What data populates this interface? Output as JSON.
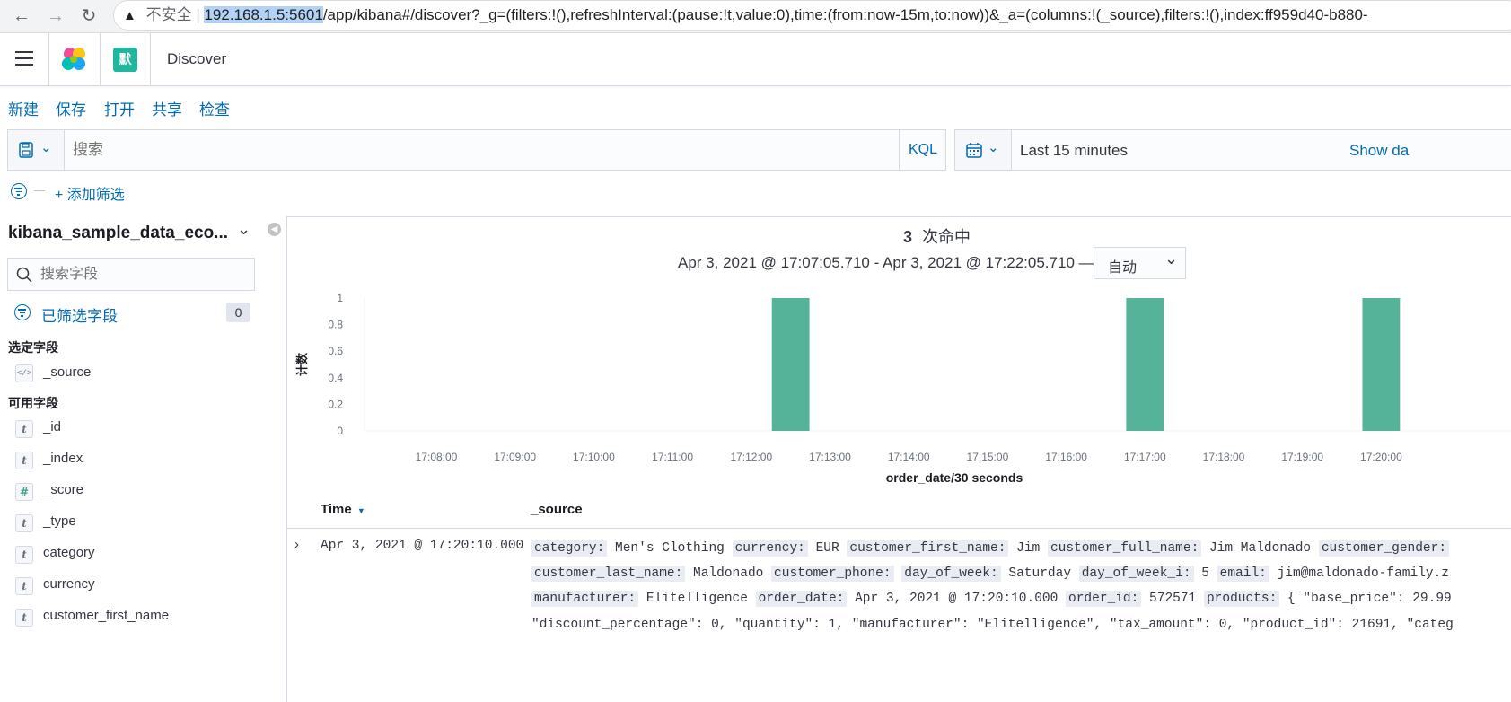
{
  "browser": {
    "security_label": "不安全",
    "url_host": "192.168.1.5:5601",
    "url_rest": "/app/kibana#/discover?_g=(filters:!(),refreshInterval:(pause:!t,value:0),time:(from:now-15m,to:now))&_a=(columns:!(_source),filters:!(),index:ff959d40-b880-"
  },
  "header": {
    "space_avatar": "默",
    "app_title": "Discover"
  },
  "top_nav": [
    "新建",
    "保存",
    "打开",
    "共享",
    "检查"
  ],
  "query": {
    "placeholder": "搜索",
    "language": "KQL"
  },
  "date_picker": {
    "range_label": "Last 15 minutes",
    "show_dates": "Show da"
  },
  "filters": {
    "add_filter": "+ 添加筛选"
  },
  "sidebar": {
    "index_pattern": "kibana_sample_data_eco...",
    "search_placeholder": "搜索字段",
    "filtered_fields_label": "已筛选字段",
    "filtered_count": "0",
    "selected_heading": "选定字段",
    "selected_fields": [
      {
        "type": "</>",
        "name": "_source"
      }
    ],
    "available_heading": "可用字段",
    "available_fields": [
      {
        "type": "t",
        "name": "_id"
      },
      {
        "type": "t",
        "name": "_index"
      },
      {
        "type": "#",
        "name": "_score"
      },
      {
        "type": "t",
        "name": "_type"
      },
      {
        "type": "t",
        "name": "category"
      },
      {
        "type": "t",
        "name": "currency"
      },
      {
        "type": "t",
        "name": "customer_first_name"
      }
    ]
  },
  "hits": {
    "count": "3",
    "label": "次命中",
    "range_text": "Apr 3, 2021 @ 17:07:05.710 - Apr 3, 2021 @ 17:22:05.710 —",
    "interval": "自动"
  },
  "chart_data": {
    "type": "bar",
    "xlabel": "order_date/30 seconds",
    "ylabel": "计数",
    "ylim": [
      0,
      1
    ],
    "yticks": [
      "1",
      "0.8",
      "0.6",
      "0.4",
      "0.2",
      "0"
    ],
    "xticks": [
      "17:08:00",
      "17:09:00",
      "17:10:00",
      "17:11:00",
      "17:12:00",
      "17:13:00",
      "17:14:00",
      "17:15:00",
      "17:16:00",
      "17:17:00",
      "17:18:00",
      "17:19:00",
      "17:20:00"
    ],
    "points": [
      {
        "x": "17:12:30",
        "y": 1
      },
      {
        "x": "17:17:00",
        "y": 1
      },
      {
        "x": "17:20:00",
        "y": 1
      }
    ],
    "color": "#54b399"
  },
  "table": {
    "col_time": "Time",
    "col_source": "_source",
    "row": {
      "time": "Apr 3, 2021 @ 17:20:10.000",
      "line1": [
        [
          "category:",
          "Men's Clothing"
        ],
        [
          "currency:",
          "EUR"
        ],
        [
          "customer_first_name:",
          "Jim"
        ],
        [
          "customer_full_name:",
          "Jim Maldonado"
        ],
        [
          "customer_gender:",
          ""
        ]
      ],
      "line2": [
        [
          "customer_last_name:",
          "Maldonado"
        ],
        [
          "customer_phone:",
          ""
        ],
        [
          "day_of_week:",
          "Saturday"
        ],
        [
          "day_of_week_i:",
          "5"
        ],
        [
          "email:",
          "jim@maldonado-family.z"
        ]
      ],
      "line3": [
        [
          "manufacturer:",
          "Elitelligence"
        ],
        [
          "order_date:",
          "Apr 3, 2021 @ 17:20:10.000"
        ],
        [
          "order_id:",
          "572571"
        ],
        [
          "products:",
          "{ \"base_price\": 29.99"
        ]
      ],
      "line4": "\"discount_percentage\": 0, \"quantity\": 1, \"manufacturer\": \"Elitelligence\", \"tax_amount\": 0, \"product_id\": 21691, \"categ"
    }
  }
}
